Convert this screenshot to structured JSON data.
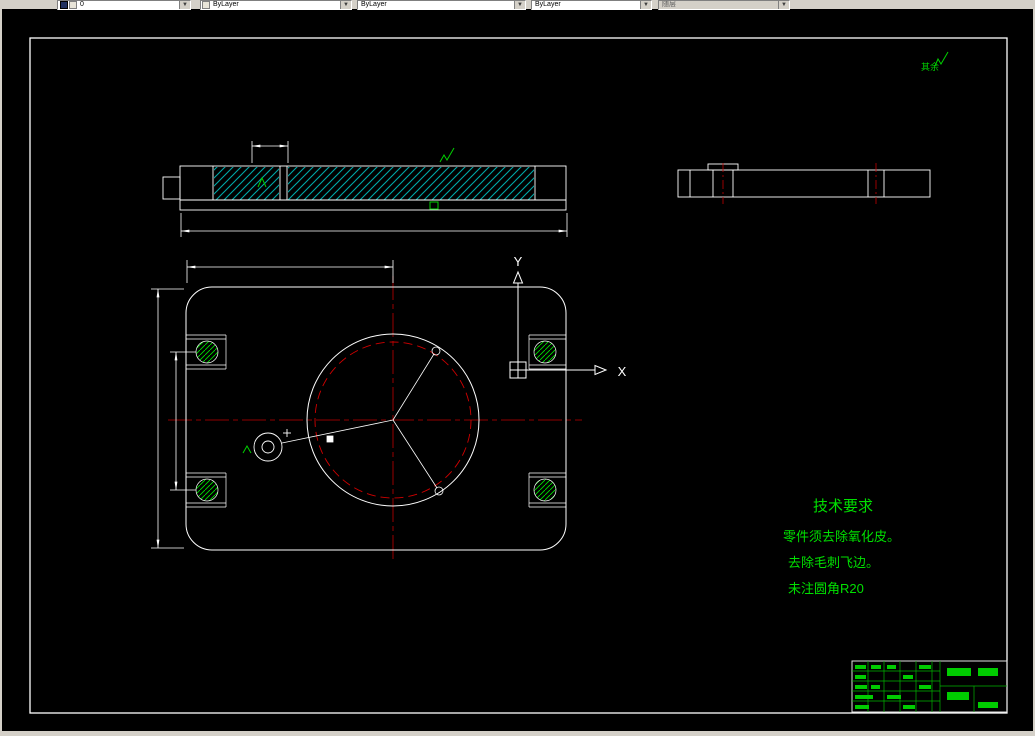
{
  "toolbar": {
    "layer_value": "0",
    "color_value": "ByLayer",
    "linetype_value": "ByLayer",
    "lineweight_value": "ByLayer",
    "plotstyle_value": "随层"
  },
  "drawing": {
    "axes": {
      "x_label": "X",
      "y_label": "Y"
    },
    "surface_note": "其余",
    "tech_requirements": {
      "title": "技术要求",
      "line1": "零件须去除氧化皮。",
      "line2": "去除毛刺飞边。",
      "line3": "未注圆角R20"
    },
    "colors": {
      "background": "#000000",
      "line": "#ffffff",
      "annotation": "#00e000",
      "centerline": "#c00000",
      "hatch": "#00a8a8"
    }
  }
}
